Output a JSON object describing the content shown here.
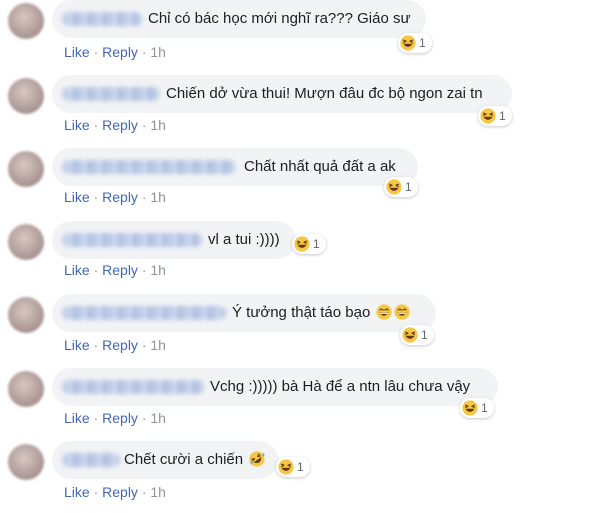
{
  "comments": [
    {
      "text": "Chỉ có bác học mới nghĩ ra??? Giáo sư",
      "reaction_count": "1",
      "like": "Like",
      "reply": "Reply",
      "sep": "·",
      "time": "1h"
    },
    {
      "text": "Chiến dở vừa thui! Mượn đâu đc bộ ngon zai tn",
      "reaction_count": "1",
      "like": "Like",
      "reply": "Reply",
      "sep": "·",
      "time": "1h"
    },
    {
      "text": "Chất nhất quả đất a ak",
      "reaction_count": "1",
      "like": "Like",
      "reply": "Reply",
      "sep": "·",
      "time": "1h"
    },
    {
      "text": "vl a tui :))))",
      "reaction_count": "1",
      "like": "Like",
      "reply": "Reply",
      "sep": "·",
      "time": "1h"
    },
    {
      "text": "Ý tưởng thật táo bạo",
      "reaction_count": "1",
      "like": "Like",
      "reply": "Reply",
      "sep": "·",
      "time": "1h"
    },
    {
      "text": "Vchg :))))) bà Hà để a ntn lâu chưa vậy",
      "reaction_count": "1",
      "like": "Like",
      "reply": "Reply",
      "sep": "·",
      "time": "1h"
    },
    {
      "text": "Chết cười a chiến",
      "reaction_count": "1",
      "like": "Like",
      "reply": "Reply",
      "sep": "·",
      "time": "1h"
    }
  ],
  "icons": {
    "reaction": "haha-emoji-icon",
    "inline_laugh": "grinning-squinting-emoji-icon",
    "inline_rofl": "rolling-on-floor-laughing-emoji-icon"
  },
  "colors": {
    "bubble": "#f2f3f5",
    "link": "#4267b2",
    "meta": "#90949c",
    "text": "#1c1e21"
  }
}
